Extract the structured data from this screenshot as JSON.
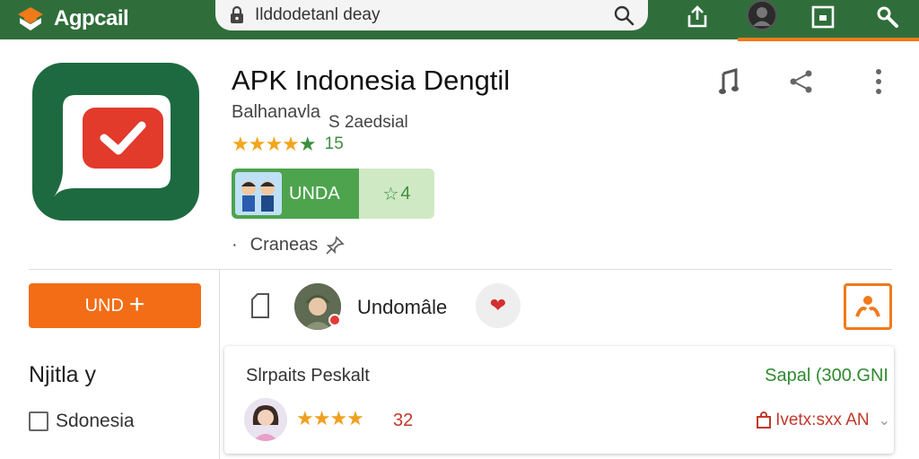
{
  "topbar": {
    "brand_name": "Agpcail",
    "search_value": "Ilddodetanl deay",
    "search_icon": "search-icon",
    "icons": [
      "upload-icon",
      "avatar",
      "window-icon",
      "wrench-icon"
    ]
  },
  "app": {
    "title": "APK Indonesia Dengtil",
    "developer": "Balhanavla",
    "size_label": "S 2aedsial",
    "rating_value": "15",
    "badge_label": "UNDA",
    "badge_star_value": "4",
    "meta_label": "Craneas",
    "meta_bullet": "·"
  },
  "sidebar": {
    "install_label": "UND",
    "install_plus": "+",
    "title": "Njitla y",
    "checkbox_label": "Sdonesia"
  },
  "user": {
    "name": "Undomâle"
  },
  "card": {
    "title": "Slrpaits Peskalt",
    "price": "Sapal (300.GNI",
    "rating_count": "32",
    "review_label": "Ivetx:sxx AN",
    "chevron": "⌄"
  },
  "colors": {
    "brand_green": "#2f6e3a",
    "accent_orange": "#f26d16",
    "icon_green": "#1e6a40",
    "icon_red": "#e23a2b",
    "star_yellow": "#f3a51c",
    "rating_green": "#3d8f3f"
  }
}
